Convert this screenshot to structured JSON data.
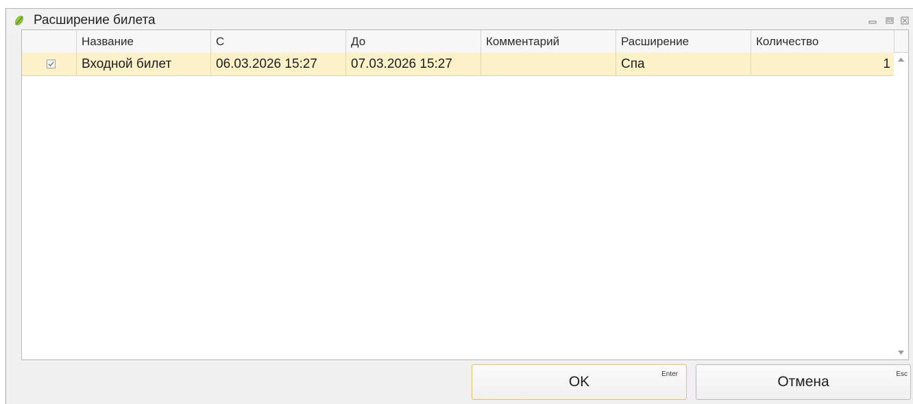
{
  "window": {
    "title": "Расширение билета",
    "app_icon": "leaf-icon",
    "controls": [
      "minimize-icon",
      "maximize-icon",
      "close-icon"
    ]
  },
  "grid": {
    "columns": [
      "",
      "Название",
      "С",
      "До",
      "Комментарий",
      "Расширение",
      "Количество"
    ],
    "rows": [
      {
        "checked": true,
        "name": "Входной билет",
        "from": "06.03.2026 15:27",
        "to": "07.03.2026 15:27",
        "comment": "",
        "extension": "Спа",
        "quantity": "1"
      }
    ],
    "selected_row_color": "#fdf1c9"
  },
  "buttons": {
    "ok": {
      "label": "OK",
      "hotkey": "Enter"
    },
    "cancel": {
      "label": "Отмена",
      "hotkey": "Esc"
    }
  }
}
